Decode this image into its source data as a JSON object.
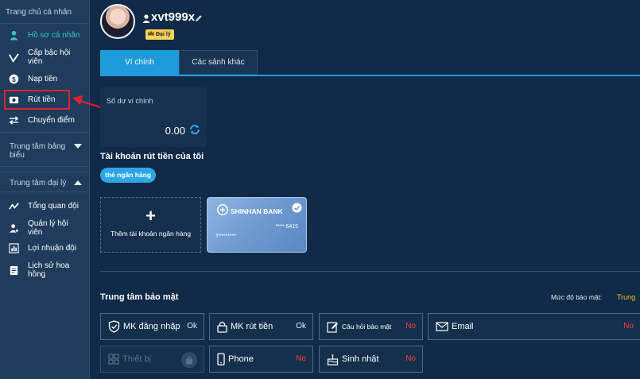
{
  "sidebar": {
    "header": "Trang chủ cá nhân",
    "items": [
      {
        "label": "Hồ sơ cá nhân",
        "icon": "user-icon"
      },
      {
        "label": "Cấp bậc hội viên",
        "icon": "rank-icon"
      },
      {
        "label": "Nạp tiền",
        "icon": "dollar-icon"
      },
      {
        "label": "Rút tiền",
        "icon": "camera-icon"
      },
      {
        "label": "Chuyển điểm",
        "icon": "transfer-icon"
      }
    ],
    "section_reports": "Trung tâm bảng biểu",
    "section_agent": "Trung tâm đại lý",
    "agent_items": [
      {
        "label": "Tổng quan đội",
        "icon": "chart-line-icon"
      },
      {
        "label": "Quản lý hội viên",
        "icon": "members-icon"
      },
      {
        "label": "Lợi nhuận đội",
        "icon": "bar-chart-icon"
      },
      {
        "label": "Lịch sử hoa hồng",
        "icon": "document-icon"
      }
    ]
  },
  "profile": {
    "username": "xvt999x",
    "badge": "Đại lý"
  },
  "tabs": [
    "Ví chính",
    "Các sảnh khác"
  ],
  "balance": {
    "title": "Số dư ví chính",
    "value": "0.00"
  },
  "withdraw_accounts": {
    "title": "Tài khoản rút tiền của tôi",
    "pill": "thẻ ngân hàng",
    "add_label": "Thêm tài khoản ngân hàng",
    "add_symbol": "+",
    "bank": {
      "name": "SHINHAN BANK",
      "number": "**** 6415",
      "holder": "T********"
    }
  },
  "security": {
    "title": "Trung tâm bảo mật",
    "level_label": "Mức độ bảo mật:",
    "level_value": "Trung",
    "items": [
      {
        "label": "MK đăng nhập",
        "status": "Ok"
      },
      {
        "label": "MK rút tiền",
        "status": "Ok"
      },
      {
        "label": "Câu hỏi bảo mật",
        "status": "No"
      },
      {
        "label": "Email",
        "status": "No"
      },
      {
        "label": "Thiết bị",
        "status": ""
      },
      {
        "label": "Phone",
        "status": "No"
      },
      {
        "label": "Sinh nhật",
        "status": "No"
      }
    ]
  },
  "colors": {
    "accent": "#1e9bd9",
    "active_menu": "#35c6c2",
    "danger": "#ff3b3b",
    "highlight": "#e0222d",
    "level": "#f0c419"
  }
}
